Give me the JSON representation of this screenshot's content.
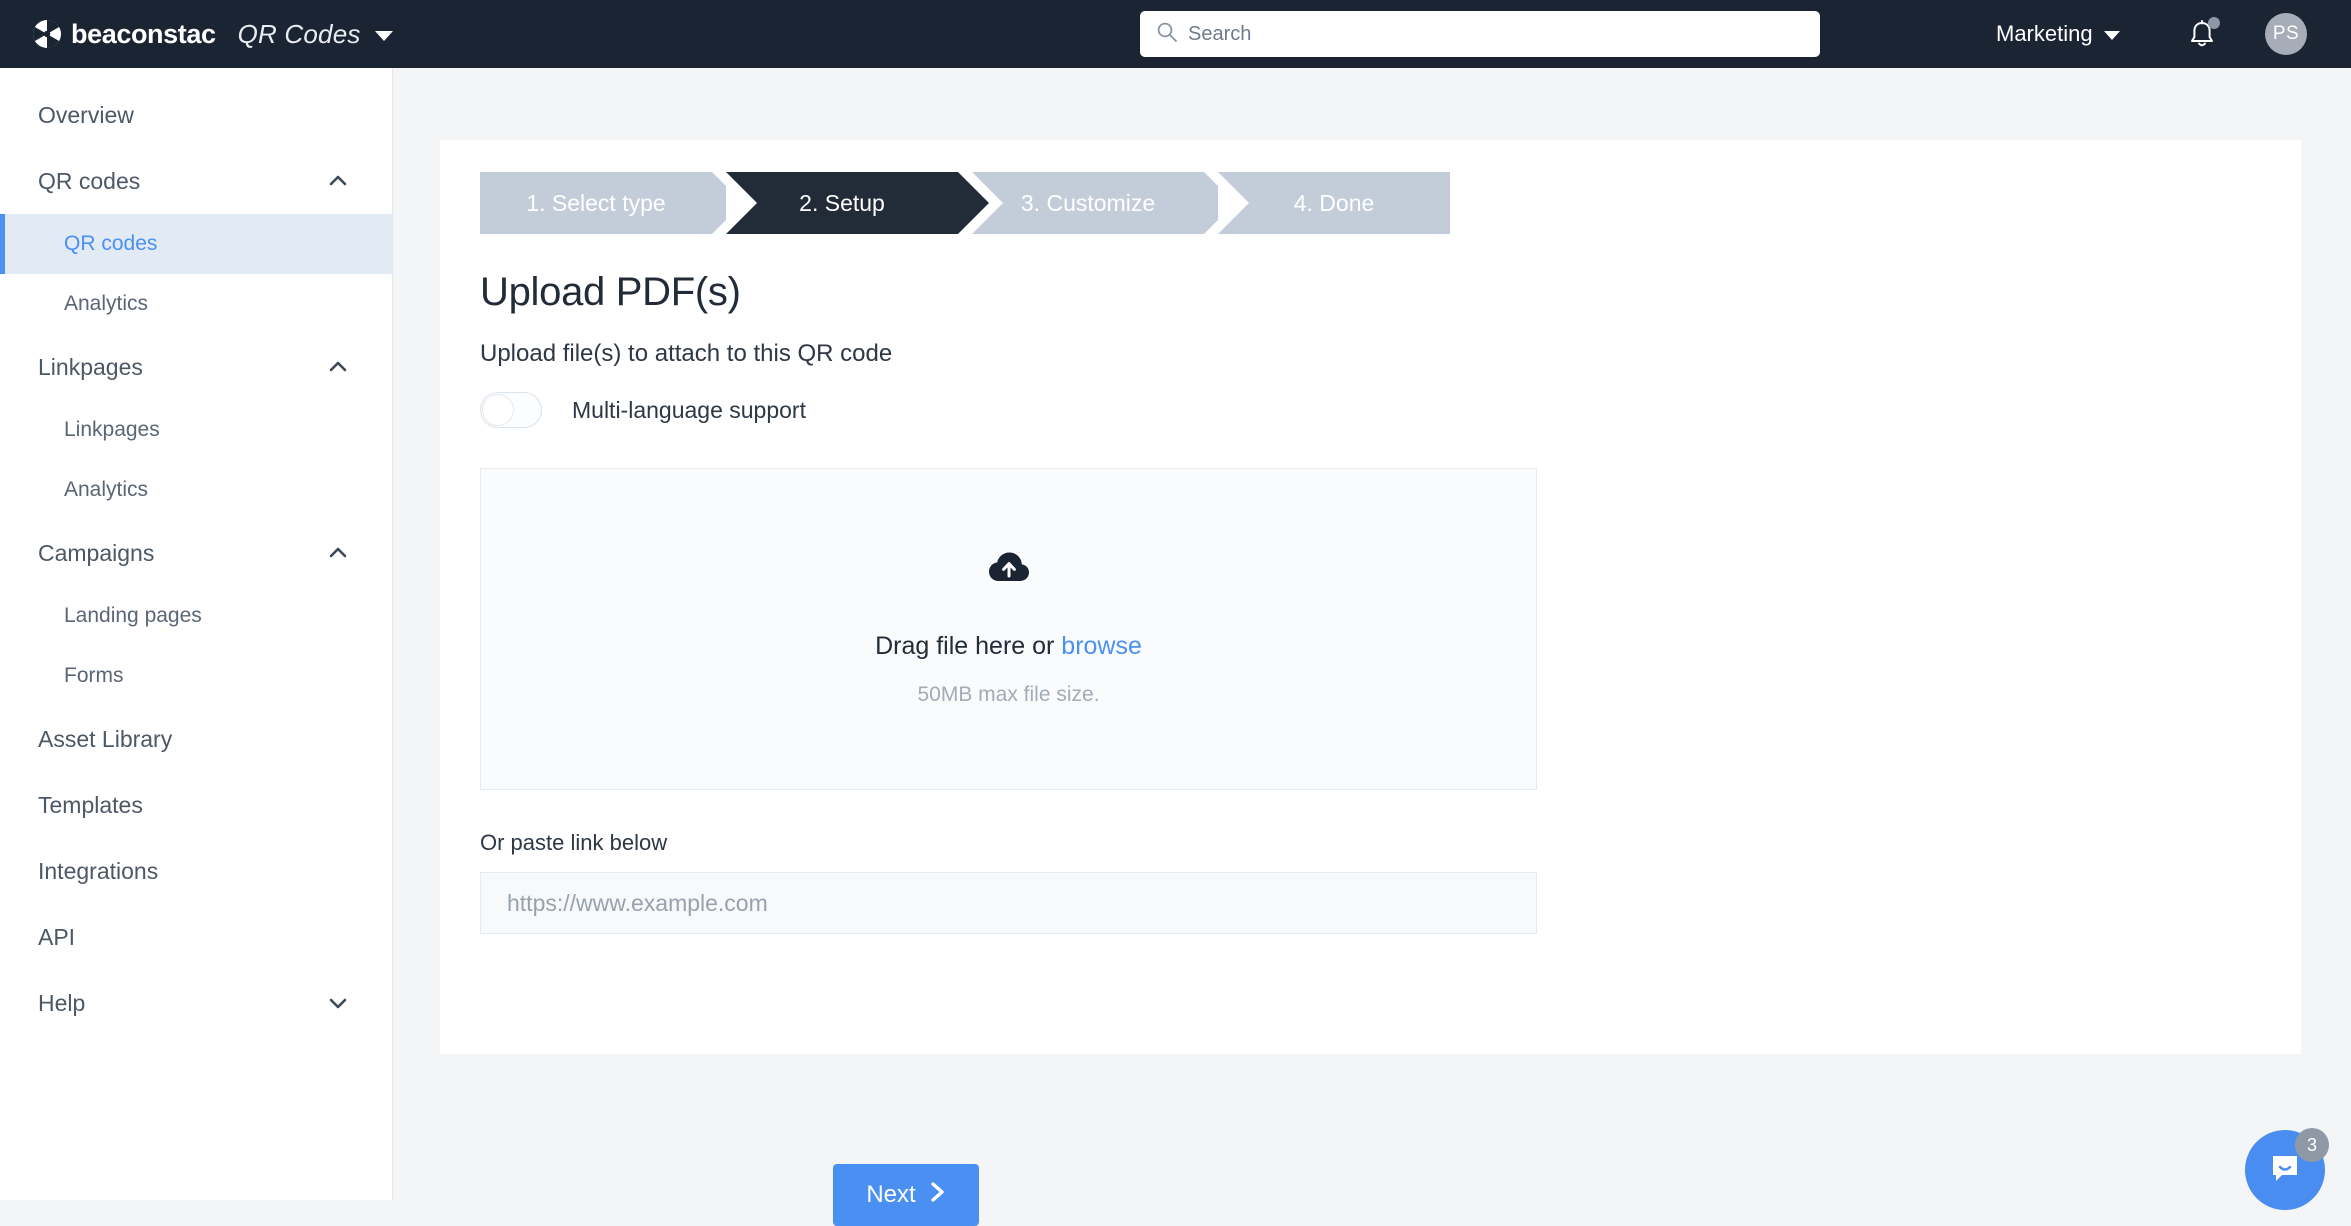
{
  "topnav": {
    "brand_name": "beaconstac",
    "brand_product": "QR Codes",
    "logo_icon": "beaconstac-logo-icon",
    "brand_caret_icon": "chevron-down-icon",
    "search": {
      "placeholder": "Search",
      "value": "",
      "icon": "search-icon"
    },
    "org": {
      "name": "Marketing",
      "caret_icon": "chevron-down-icon"
    },
    "notifications": {
      "icon": "bell-icon",
      "has_unread": true
    },
    "avatar": {
      "initials": "PS"
    }
  },
  "sidebar": {
    "items": [
      {
        "label": "Overview",
        "level": "top",
        "active": false,
        "chevron": ""
      },
      {
        "label": "QR codes",
        "level": "top",
        "active": false,
        "chevron": "chevron-up-icon"
      },
      {
        "label": "QR codes",
        "level": "sub",
        "active": true,
        "chevron": ""
      },
      {
        "label": "Analytics",
        "level": "sub",
        "active": false,
        "chevron": ""
      },
      {
        "label": "Linkpages",
        "level": "top",
        "active": false,
        "chevron": "chevron-up-icon"
      },
      {
        "label": "Linkpages",
        "level": "sub",
        "active": false,
        "chevron": ""
      },
      {
        "label": "Analytics",
        "level": "sub",
        "active": false,
        "chevron": ""
      },
      {
        "label": "Campaigns",
        "level": "top",
        "active": false,
        "chevron": "chevron-up-icon"
      },
      {
        "label": "Landing pages",
        "level": "sub",
        "active": false,
        "chevron": ""
      },
      {
        "label": "Forms",
        "level": "sub",
        "active": false,
        "chevron": ""
      },
      {
        "label": "Asset Library",
        "level": "top",
        "active": false,
        "chevron": ""
      },
      {
        "label": "Templates",
        "level": "top",
        "active": false,
        "chevron": ""
      },
      {
        "label": "Integrations",
        "level": "top",
        "active": false,
        "chevron": ""
      },
      {
        "label": "API",
        "level": "top",
        "active": false,
        "chevron": ""
      },
      {
        "label": "Help",
        "level": "top",
        "active": false,
        "chevron": "chevron-down-icon"
      }
    ]
  },
  "wizard": {
    "steps": [
      {
        "label": "1. Select type",
        "active": false
      },
      {
        "label": "2. Setup",
        "active": true
      },
      {
        "label": "3. Customize",
        "active": false
      },
      {
        "label": "4. Done",
        "active": false
      }
    ]
  },
  "main": {
    "title": "Upload PDF(s)",
    "subtitle": "Upload file(s) to attach to this QR code",
    "multilang_toggle": {
      "label": "Multi-language support",
      "enabled": false
    },
    "dropzone": {
      "icon": "cloud-upload-icon",
      "text_before": "Drag file here or ",
      "browse_label": "browse",
      "hint": "50MB max file size."
    },
    "link_field": {
      "label": "Or paste link below",
      "placeholder": "https://www.example.com",
      "value": ""
    },
    "next_button": {
      "label": "Next",
      "icon": "chevron-right-icon"
    }
  },
  "chat": {
    "icon": "chat-bubble-icon",
    "unread_count": "3"
  },
  "colors": {
    "accent_blue": "#4a90f2",
    "nav_dark": "#1b2433",
    "step_inactive": "#c3cdd9",
    "step_active": "#222b38",
    "page_bg": "#f4f5f7"
  }
}
